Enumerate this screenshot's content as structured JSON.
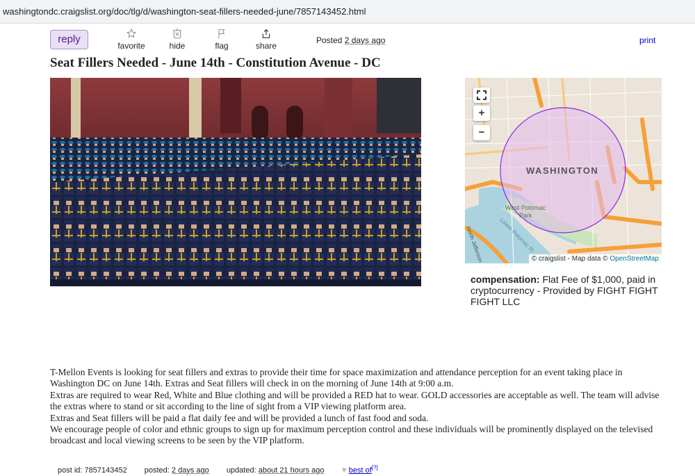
{
  "browser": {
    "url": "washingtondc.craigslist.org/doc/tlg/d/washington-seat-fillers-needed-june/7857143452.html"
  },
  "toolbar": {
    "reply_label": "reply",
    "favorite_label": "favorite",
    "hide_label": "hide",
    "flag_label": "flag",
    "share_label": "share",
    "posted_prefix": "Posted",
    "posted_value": "2 days ago",
    "print_label": "print"
  },
  "posting": {
    "title": "Seat Fillers Needed - June 14th - Constitution Avenue - DC",
    "compensation_label": "compensation:",
    "compensation_value": "Flat Fee of $1,000, paid in cryptocurrency - Provided by FIGHT FIGHT FIGHT LLC",
    "body": [
      "T-Mellon Events is looking for seat fillers and extras to provide their time for space maximization and attendance perception for an event taking place in Washington DC on June 14th. Extras and Seat fillers will check in on the morning of June 14th at 9:00 a.m.",
      "Extras are required to wear Red, White and Blue clothing and will be provided a RED hat to wear. GOLD accessories are acceptable as well. The team will advise the extras where to stand or sit according to the line of sight from a VIP viewing platform area.",
      "Extras and Seat fillers will be paid a flat daily fee and will be provided a lunch of fast food and soda.",
      "We encourage people of color and ethnic groups to sign up for maximum perception control and these individuals will be prominently displayed on the televised broadcast and local viewing screens to be seen by the VIP platform."
    ]
  },
  "map": {
    "city_label": "WASHINGTON",
    "park_label_1": "West Potomac",
    "park_label_2": "Park",
    "river_label": "Lower Potomac Ri",
    "road_label": "North Jefferson D",
    "zoom_in": "+",
    "zoom_out": "−",
    "attribution_prefix": "© craigslist - Map data ©",
    "attribution_link": "OpenStreetMap"
  },
  "footer": {
    "post_id_label": "post id: 7857143452",
    "posted_label": "posted:",
    "posted_value": "2 days ago",
    "updated_label": "updated:",
    "updated_value": "about 21 hours ago",
    "best_of_label": "best of",
    "best_of_sup": "[?]"
  },
  "colors": {
    "reply_bg": "#e8e0f5",
    "link_blue": "#0000cc",
    "map_circle": "#8a2be2"
  },
  "icons": {
    "favorite": "star-icon",
    "hide": "hide-icon",
    "flag": "flag-icon",
    "share": "share-icon",
    "fullscreen": "fullscreen-icon",
    "best_of": "heart-icon"
  }
}
